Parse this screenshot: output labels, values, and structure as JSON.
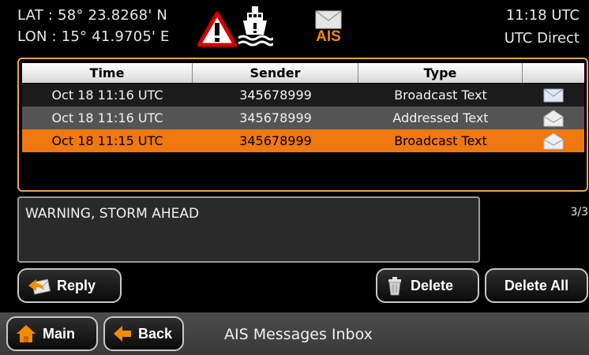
{
  "header": {
    "lat": "LAT : 58° 23.8268' N",
    "lon": "LON : 15° 41.9705' E",
    "time": "11:18 UTC",
    "time_source": "UTC Direct",
    "ais_label": "AIS",
    "icons": [
      "warning-triangle-icon",
      "ship-alarm-icon",
      "ais-envelope-icon"
    ]
  },
  "table": {
    "columns": [
      "Time",
      "Sender",
      "Type",
      ""
    ],
    "rows": [
      {
        "time": "Oct 18 11:16 UTC",
        "sender": "345678999",
        "type": "Broadcast Text",
        "icon": "envelope-closed-icon"
      },
      {
        "time": "Oct 18 11:16 UTC",
        "sender": "345678999",
        "type": "Addressed Text",
        "icon": "envelope-open-icon"
      },
      {
        "time": "Oct 18 11:15 UTC",
        "sender": "345678999",
        "type": "Broadcast Text",
        "icon": "envelope-open-icon"
      }
    ],
    "selected_row": 2
  },
  "message": {
    "text": "WARNING, STORM AHEAD",
    "page_count": "3/3"
  },
  "actions": {
    "reply": "Reply",
    "delete": "Delete",
    "delete_all": "Delete All"
  },
  "nav": {
    "main": "Main",
    "back": "Back",
    "title": "AIS Messages Inbox"
  },
  "colors": {
    "accent": "#f07810",
    "table_border": "#f0a050",
    "warning_red": "#d40000"
  }
}
